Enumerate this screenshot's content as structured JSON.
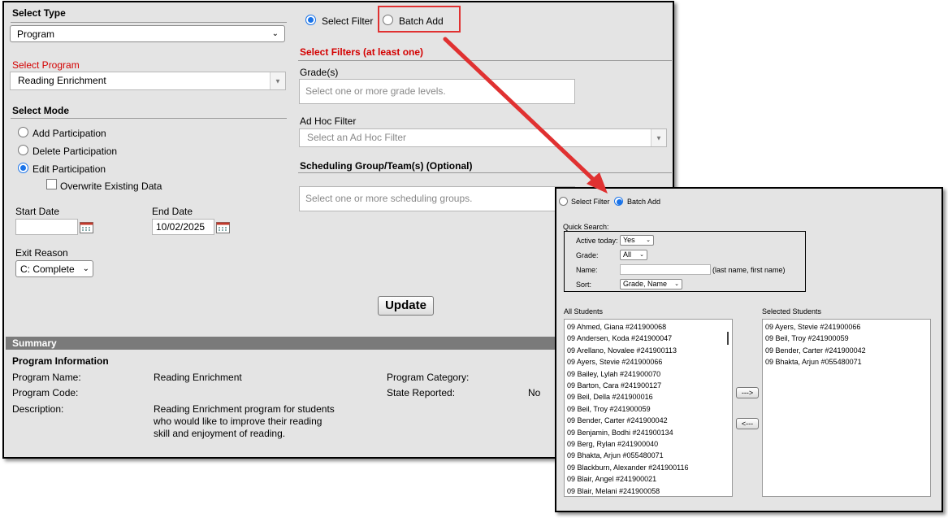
{
  "left": {
    "select_type": {
      "label": "Select Type",
      "value": "Program"
    },
    "select_program": {
      "label": "Select Program",
      "value": "Reading Enrichment"
    },
    "select_mode": {
      "label": "Select Mode",
      "options": [
        "Add Participation",
        "Delete Participation",
        "Edit Participation"
      ],
      "selected": "Edit Participation",
      "overwrite_label": "Overwrite Existing Data"
    },
    "start_date": {
      "label": "Start Date",
      "value": ""
    },
    "end_date": {
      "label": "End Date",
      "value": "10/02/2025"
    },
    "exit_reason": {
      "label": "Exit Reason",
      "value": "C: Complete"
    }
  },
  "right": {
    "radio_select_filter": "Select Filter",
    "radio_batch_add": "Batch Add",
    "filters_title": "Select Filters (at least one)",
    "grades": {
      "label": "Grade(s)",
      "placeholder": "Select one or more grade levels."
    },
    "adhoc": {
      "label": "Ad Hoc Filter",
      "placeholder": "Select an Ad Hoc Filter"
    },
    "scheduling": {
      "label": "Scheduling Group/Team(s) (Optional)",
      "placeholder": "Select one or more scheduling groups."
    },
    "update_label": "Update"
  },
  "summary": {
    "bar_label": "Summary",
    "heading": "Program Information",
    "program_name_label": "Program Name:",
    "program_name_value": "Reading Enrichment",
    "program_code_label": "Program Code:",
    "description_label": "Description:",
    "description_lines": [
      "Reading Enrichment program for students",
      "who would like to improve their reading",
      "skill and enjoyment of reading."
    ],
    "program_category_label": "Program Category:",
    "state_reported_label": "State Reported:",
    "state_reported_value": "No"
  },
  "batch": {
    "radio_select_filter": "Select Filter",
    "radio_batch_add": "Batch Add",
    "quick_search_label": "Quick Search:",
    "active_today_label": "Active today:",
    "active_today_value": "Yes",
    "grade_label": "Grade:",
    "grade_value": "All",
    "name_label": "Name:",
    "name_value": "",
    "name_hint": "(last name, first name)",
    "sort_label": "Sort:",
    "sort_value": "Grade, Name",
    "all_students_label": "All Students",
    "selected_students_label": "Selected Students",
    "add_button": "--->",
    "remove_button": "<---",
    "all_students": [
      "09 Ahmed, Giana  #241900068",
      "09 Andersen, Koda  #241900047",
      "09 Arellano, Novalee  #241900113",
      "09 Ayers, Stevie  #241900066",
      "09 Bailey, Lylah  #241900070",
      "09 Barton, Cara  #241900127",
      "09 Beil, Della  #241900016",
      "09 Beil, Troy  #241900059",
      "09 Bender, Carter  #241900042",
      "09 Benjamin, Bodhi  #241900134",
      "09 Berg, Rylan  #241900040",
      "09 Bhakta, Arjun  #055480071",
      "09 Blackburn, Alexander  #241900116",
      "09 Blair, Angel  #241900021",
      "09 Blair, Melani  #241900058"
    ],
    "selected_students": [
      "09 Ayers, Stevie  #241900066",
      "09 Beil, Troy  #241900059",
      "09 Bender, Carter  #241900042",
      "09 Bhakta, Arjun  #055480071"
    ]
  },
  "colors": {
    "highlight_red": "#e03131",
    "radio_blue": "#1a73e8",
    "required_red": "#d40000"
  },
  "icons": [
    "calendar-icon",
    "chevron-down-icon",
    "arrow-annotation"
  ]
}
